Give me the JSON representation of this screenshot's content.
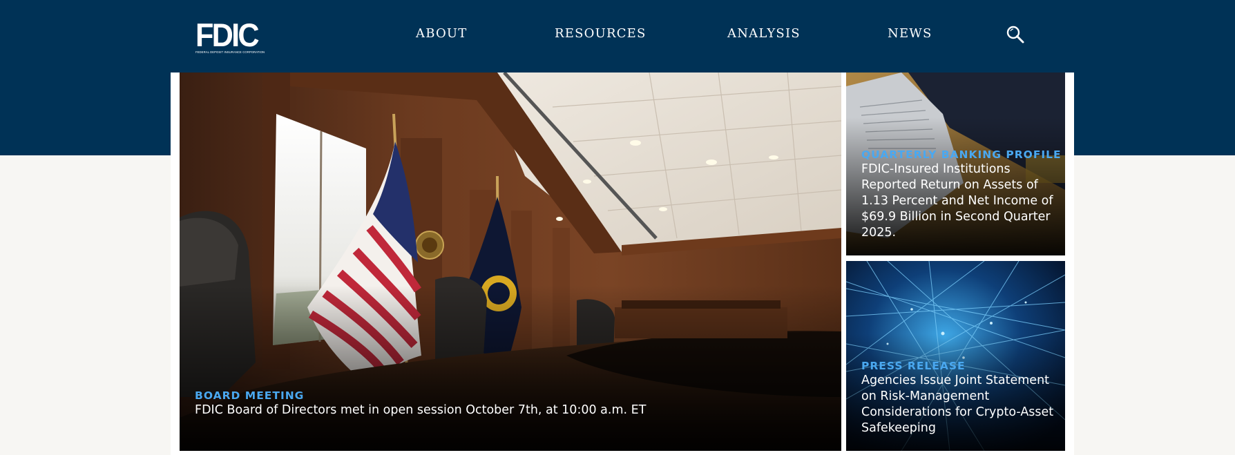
{
  "header": {
    "logo_text": "FDIC",
    "logo_subtext": "FEDERAL DEPOSIT INSURANCE CORPORATION",
    "nav": [
      {
        "label": "ABOUT"
      },
      {
        "label": "RESOURCES"
      },
      {
        "label": "ANALYSIS"
      },
      {
        "label": "NEWS"
      }
    ],
    "search_icon": "search-icon"
  },
  "featured": {
    "main": {
      "kicker": "BOARD MEETING",
      "headline": "FDIC Board of Directors met in open session October 7th, at 10:00 a.m. ET"
    },
    "side_top": {
      "kicker": "QUARTERLY BANKING PROFILE",
      "headline": "FDIC-Insured Institutions Reported Return on Assets of 1.13 Percent and Net Income of $69.9 Billion in Second Quarter 2025."
    },
    "side_bottom": {
      "kicker": "PRESS RELEASE",
      "headline": "Agencies Issue Joint Statement on Risk-Management Considerations for Crypto-Asset Safekeeping"
    }
  },
  "colors": {
    "navy": "#003256",
    "kicker_blue": "#4aa8f0",
    "page_background": "#f7f6f3"
  }
}
